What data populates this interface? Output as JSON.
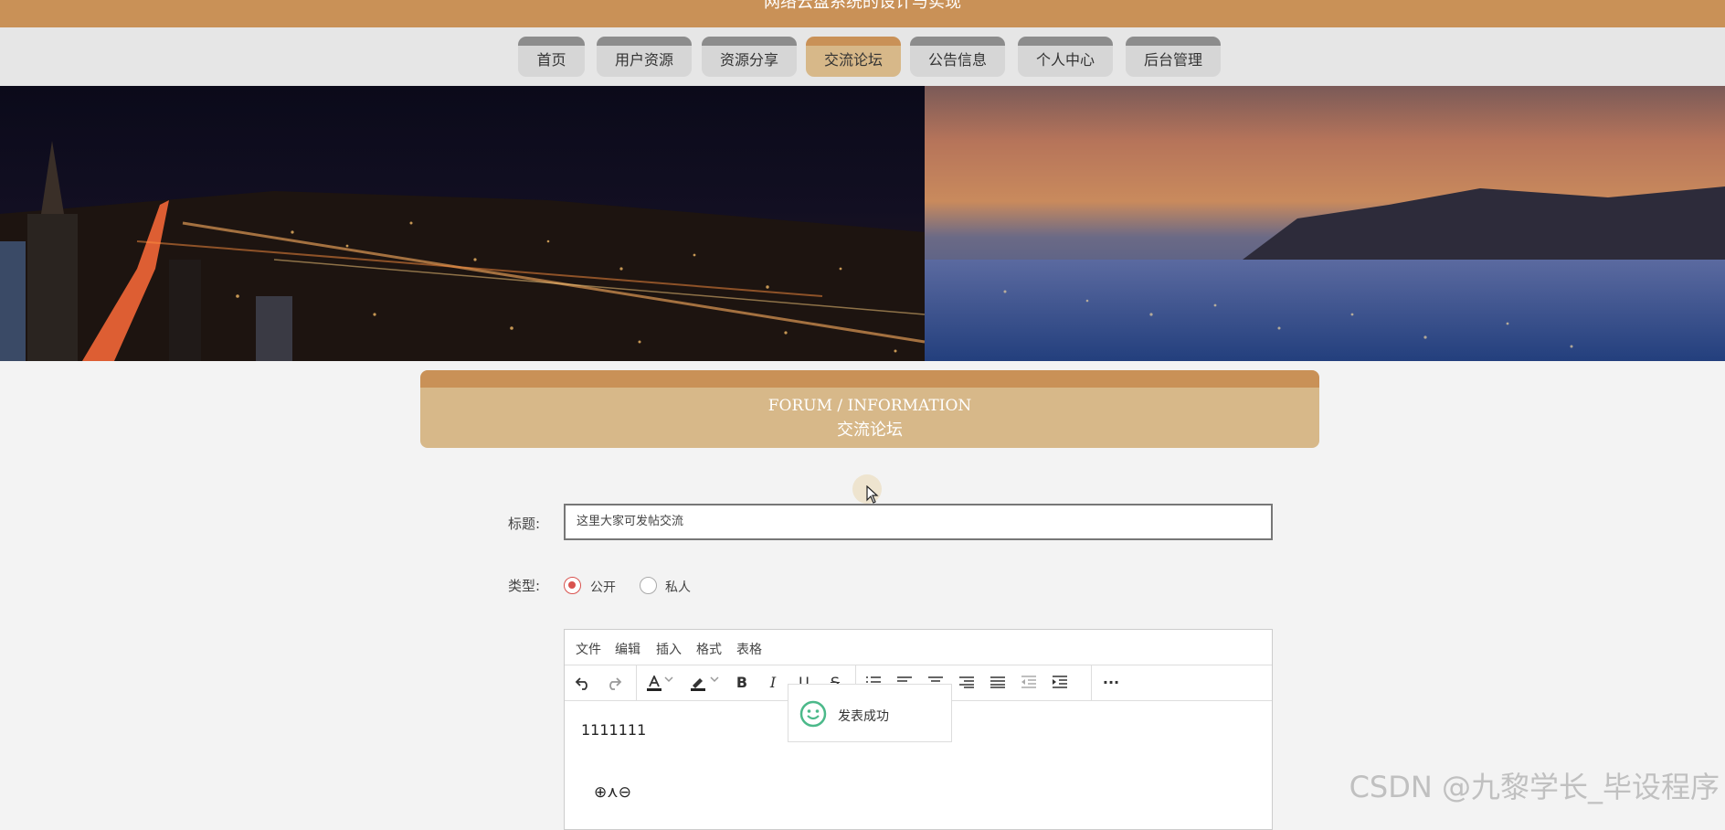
{
  "header": {
    "title": "网络云盘系统的设计与实现"
  },
  "nav": {
    "items": [
      {
        "label": "首页",
        "active": false
      },
      {
        "label": "用户资源",
        "active": false
      },
      {
        "label": "资源分享",
        "active": false
      },
      {
        "label": "交流论坛",
        "active": true
      },
      {
        "label": "公告信息",
        "active": false
      },
      {
        "label": "个人中心",
        "active": false
      },
      {
        "label": "后台管理",
        "active": false
      }
    ]
  },
  "section": {
    "title_en": "FORUM / INFORMATION",
    "title_zh": "交流论坛"
  },
  "form": {
    "title_label": "标题:",
    "title_value": "这里大家可发帖交流",
    "type_label": "类型:",
    "type_options": [
      {
        "label": "公开",
        "selected": true
      },
      {
        "label": "私人",
        "selected": false
      }
    ]
  },
  "editor": {
    "menu": [
      "文件",
      "编辑",
      "插入",
      "格式",
      "表格"
    ],
    "toolbar_icons": [
      "undo-icon",
      "redo-icon",
      "font-color-icon",
      "highlight-color-icon",
      "bold-icon",
      "italic-icon",
      "underline-icon",
      "strikethrough-icon",
      "ordered-list-icon",
      "align-left-icon",
      "align-center-icon",
      "align-right-icon",
      "align-justify-icon",
      "outdent-icon",
      "indent-icon",
      "more-icon"
    ],
    "content_text": "1111111",
    "formula_text": "⊕⋏⊖"
  },
  "toast": {
    "message": "发表成功",
    "icon": "smile-icon"
  },
  "watermark": "CSDN @九黎学长_毕设程序",
  "colors": {
    "brand": "#c99157",
    "brand_light": "#d7b889",
    "nav_bg": "#e6e6e6",
    "nav_item_bg": "#d6d6d6",
    "radio_on": "#d9534f"
  }
}
